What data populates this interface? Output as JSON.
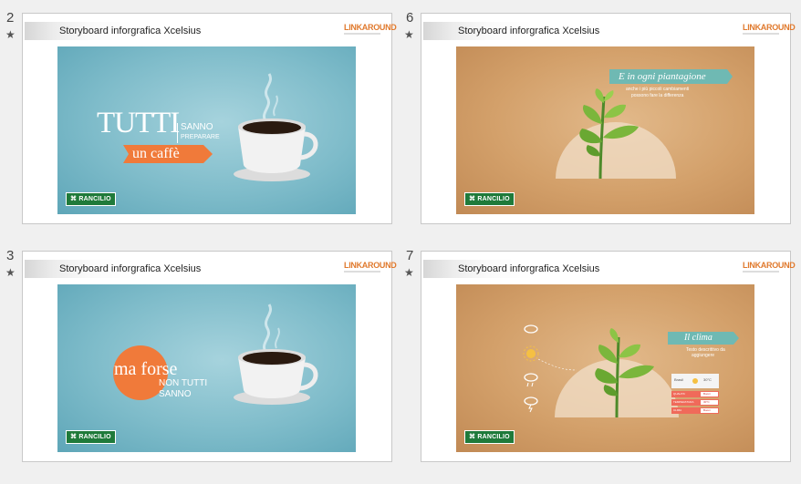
{
  "slides": [
    {
      "number": "2",
      "title": "Storyboard inforgrafica Xcelsius",
      "logo": "LINKAROUND",
      "brand": "RANCILIO",
      "headline_big": "TUTTI",
      "headline_small_1": "SANNO",
      "headline_small_2": "PREPARARE",
      "ribbon_text": "un caffè"
    },
    {
      "number": "6",
      "title": "Storyboard inforgrafica Xcelsius",
      "logo": "LINKAROUND",
      "brand": "RANCILIO",
      "banner_title": "E in ogni piantagione",
      "banner_sub_1": "anche i più piccoli cambiamenti",
      "banner_sub_2": "possono fare la differenza"
    },
    {
      "number": "3",
      "title": "Storyboard inforgrafica Xcelsius",
      "logo": "LINKAROUND",
      "brand": "RANCILIO",
      "badge_text": "ma forse",
      "line_1": "NON TUTTI",
      "line_2": "SANNO"
    },
    {
      "number": "7",
      "title": "Storyboard inforgrafica Xcelsius",
      "logo": "LINKAROUND",
      "brand": "RANCILIO",
      "banner_title": "Il clima",
      "banner_sub_1": "Testo descrittivo da",
      "banner_sub_2": "aggiungere",
      "panel_city": "Brasil",
      "panel_temp": "30°C",
      "rows": [
        {
          "label": "QUALITA'",
          "value": "Buoni"
        },
        {
          "label": "TEMPERATURA",
          "value": "30°C"
        },
        {
          "label": "CLIMA",
          "value": "Buoni"
        }
      ]
    }
  ],
  "colors": {
    "blue_bg": "#7fbcca",
    "tan_bg": "#d3a06a",
    "orange": "#f07a3a",
    "teal": "#6fb9b3",
    "green": "#1f7a3a"
  }
}
